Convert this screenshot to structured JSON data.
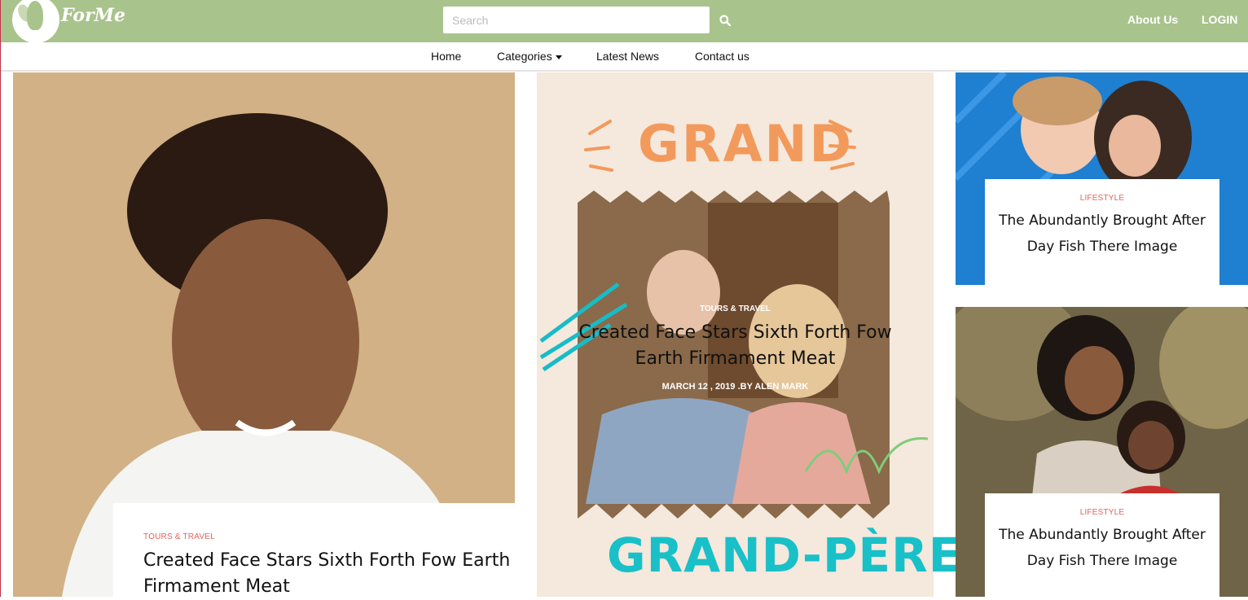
{
  "brand": {
    "name": "ForMe",
    "colors": {
      "topbar": "#a9c38c",
      "accent": "#e2635c"
    }
  },
  "search": {
    "placeholder": "Search",
    "icon": "search-icon"
  },
  "top_links": {
    "about": "About Us",
    "login": "LOGIN"
  },
  "nav": {
    "home": "Home",
    "categories": "Categories",
    "latest": "Latest News",
    "contact": "Contact us"
  },
  "posts": [
    {
      "category": "TOURS & TRAVEL",
      "title": "Created Face Stars Sixth Forth Fow Earth Firmament Meat"
    },
    {
      "category": "TOURS & TRAVEL",
      "title": "Created Face Stars Sixth Forth Fow Earth Firmament Meat",
      "meta": "MARCH 12 , 2019 .BY ALEN MARK",
      "poster_top": "GRAND",
      "poster_bottom": "GRAND-PÈRE"
    },
    {
      "category": "LIFESTYLE",
      "title": "The Abundantly Brought After Day Fish There Image"
    },
    {
      "category": "LIFESTYLE",
      "title": "The Abundantly Brought After Day Fish There Image"
    }
  ]
}
